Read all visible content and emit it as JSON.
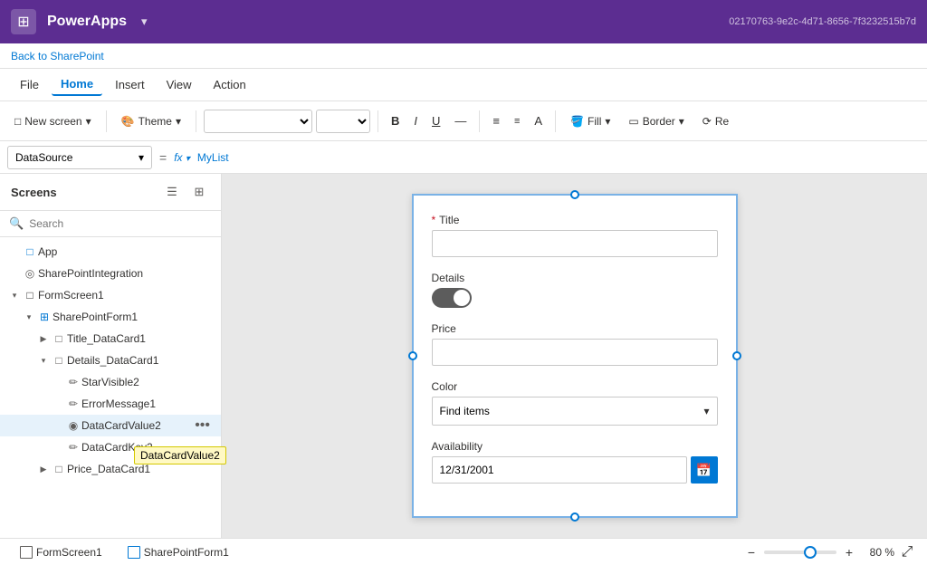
{
  "titleBar": {
    "appIcon": "⊞",
    "title": "PowerApps",
    "chevron": "▾",
    "id": "02170763-9e2c-4d71-8656-7f3232515b7d"
  },
  "sharePointLink": "Back to SharePoint",
  "menuBar": {
    "items": [
      {
        "label": "File",
        "active": false
      },
      {
        "label": "Home",
        "active": true
      },
      {
        "label": "Insert",
        "active": false
      },
      {
        "label": "View",
        "active": false
      },
      {
        "label": "Action",
        "active": false
      }
    ]
  },
  "toolbar": {
    "newScreenLabel": "New screen",
    "themeLabel": "Theme",
    "boldLabel": "B",
    "fillLabel": "Fill",
    "borderLabel": "Border",
    "reLabel": "Re"
  },
  "formulaBar": {
    "source": "DataSource",
    "equalsSign": "=",
    "fxLabel": "fx",
    "value": "MyList"
  },
  "sidebar": {
    "title": "Screens",
    "searchPlaceholder": "Search",
    "treeItems": [
      {
        "level": 0,
        "label": "App",
        "icon": "□",
        "expandable": false,
        "type": "app"
      },
      {
        "level": 0,
        "label": "SharePointIntegration",
        "icon": "◎",
        "expandable": false,
        "type": "integration"
      },
      {
        "level": 0,
        "label": "FormScreen1",
        "icon": "□",
        "expandable": true,
        "expanded": true,
        "type": "screen"
      },
      {
        "level": 1,
        "label": "SharePointForm1",
        "icon": "⊞",
        "expandable": true,
        "expanded": true,
        "type": "form"
      },
      {
        "level": 2,
        "label": "Title_DataCard1",
        "icon": "□",
        "expandable": true,
        "expanded": false,
        "type": "card"
      },
      {
        "level": 2,
        "label": "Details_DataCard1",
        "icon": "□",
        "expandable": true,
        "expanded": true,
        "type": "card"
      },
      {
        "level": 3,
        "label": "StarVisible2",
        "icon": "✏",
        "expandable": false,
        "type": "control"
      },
      {
        "level": 3,
        "label": "ErrorMessage1",
        "icon": "✏",
        "expandable": false,
        "type": "control"
      },
      {
        "level": 3,
        "label": "DataCardValue2",
        "icon": "◉",
        "expandable": false,
        "type": "control",
        "selected": true,
        "showMore": true
      },
      {
        "level": 3,
        "label": "DataCardKey2",
        "icon": "✏",
        "expandable": false,
        "type": "control"
      },
      {
        "level": 2,
        "label": "Price_DataCard1",
        "icon": "□",
        "expandable": true,
        "expanded": false,
        "type": "card"
      }
    ],
    "tooltip": "DataCardValue2"
  },
  "form": {
    "fields": [
      {
        "name": "titleField",
        "label": "Title",
        "type": "text",
        "required": true,
        "value": ""
      },
      {
        "name": "detailsField",
        "label": "Details",
        "type": "toggle",
        "value": true
      },
      {
        "name": "priceField",
        "label": "Price",
        "type": "text",
        "required": false,
        "value": ""
      },
      {
        "name": "colorField",
        "label": "Color",
        "type": "dropdown",
        "value": "Find items"
      },
      {
        "name": "availabilityField",
        "label": "Availability",
        "type": "date",
        "value": "12/31/2001"
      }
    ]
  },
  "bottomBar": {
    "screens": [
      {
        "label": "FormScreen1"
      },
      {
        "label": "SharePointForm1"
      }
    ],
    "zoomMinus": "−",
    "zoomPlus": "+",
    "zoomValue": "80 %",
    "fitScreen": "⤢"
  }
}
